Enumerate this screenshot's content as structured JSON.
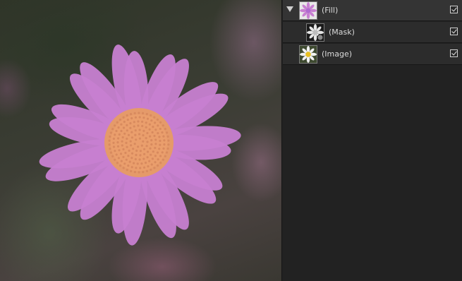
{
  "canvas": {
    "description_colors": {
      "fill": "#c77fd1",
      "center": "#e8a06a"
    }
  },
  "layers_panel": {
    "layers": [
      {
        "name": "(Fill)",
        "icon": "fill-thumbnail-icon",
        "expanded": true,
        "visible": true
      },
      {
        "name": "(Mask)",
        "icon": "mask-thumbnail-icon",
        "visible": true
      },
      {
        "name": "(Image)",
        "icon": "image-thumbnail-icon",
        "visible": true
      }
    ]
  }
}
